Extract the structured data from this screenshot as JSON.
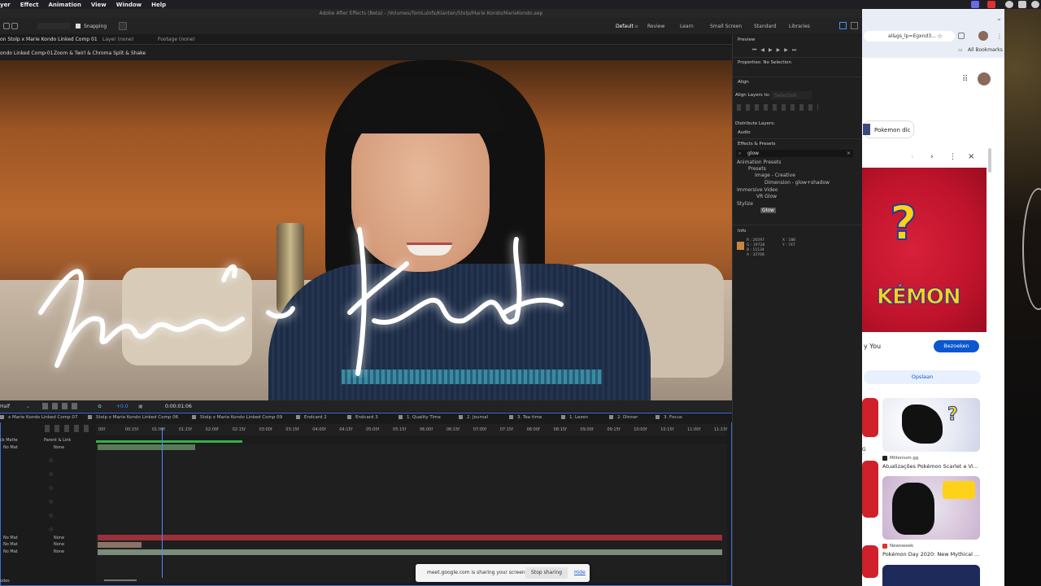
{
  "menubar": {
    "items": [
      "yer",
      "Effect",
      "Animation",
      "View",
      "Window",
      "Help"
    ]
  },
  "app": {
    "title": "Adobe After Effects (Beta) - /Volumes/TomLulofs/Klanten/Stolp/Marie Kondo/MarieKondo.aep",
    "toolbar": {
      "snapping": "Snapping"
    },
    "workspaces": [
      "Default",
      "Review",
      "Learn",
      "Small Screen",
      "Standard",
      "Libraries"
    ]
  },
  "viewer": {
    "tabs": [
      "on Stolp x Marie Kondo Linked Comp 01",
      "Layer (none)",
      "Footage (none)"
    ],
    "crumbs": [
      "ondo Linked Comp 01",
      "Zoom & Twirl & Chroma Split & Shake"
    ],
    "resolution": "Half",
    "timecode": "0:00:01:06",
    "exposure": "+0.0"
  },
  "panels": {
    "preview": "Preview",
    "properties": "Properties: No Selection",
    "align": "Align",
    "align_layers_to": "Align Layers to:",
    "align_target": "Selection",
    "distribute": "Distribute Layers:",
    "audio": "Audio",
    "effects": "Effects & Presets",
    "search_value": "glow",
    "tree": [
      "Animation Presets",
      "Presets",
      "Image - Creative",
      "Dimension - glow+shadow",
      "Immersive Video",
      "VR Glow",
      "Stylize",
      "Glow"
    ],
    "info": "Info",
    "info_values": [
      "R : 26597",
      "G : 19728",
      "B : 11134",
      "A : 32768"
    ],
    "info_xy": [
      "X : 188",
      "Y : 747"
    ]
  },
  "timeline": {
    "tabs": [
      "x Marie Kondo Linked Comp 07",
      "Stolp x Marie Kondo Linked Comp 06",
      "Stolp x Marie Kondo Linked Comp 09",
      "Endcard 2",
      "Endcard 3",
      "1. Quality Time",
      "2. Journal",
      "3. Tea time",
      "1. Lezen",
      "2. Dinner",
      "3. Focus"
    ],
    "ticks": [
      "00f",
      "00:15f",
      "01:00f",
      "01:15f",
      "02:00f",
      "02:15f",
      "03:00f",
      "03:15f",
      "04:00f",
      "04:15f",
      "05:00f",
      "05:15f",
      "06:00f",
      "06:15f",
      "07:00f",
      "07:15f",
      "08:00f",
      "08:15f",
      "09:00f",
      "09:15f",
      "10:00f",
      "10:15f",
      "11:00f",
      "11:15f"
    ],
    "col_parent": "Parent & Link",
    "col_matte": "ck Matte",
    "none": "None",
    "nomat": "No Mat",
    "toggles": "odes"
  },
  "share": {
    "text": "meet.google.com is sharing your screen.",
    "stop": "Stop sharing",
    "hide": "Hide"
  },
  "browser": {
    "url": "al&gs_lp=Egxnd3...",
    "bookmarks": "All Bookmarks",
    "chip": "Pokemon dlc",
    "card_word": "KÉMON",
    "for_you": "y You",
    "visit": "Bezoeken",
    "save": "Opslaan",
    "results": [
      {
        "source": "Millenium.gg",
        "caption": "Atualizações Pokémon Scarlet e Vi..."
      },
      {
        "source": "Newsweek",
        "caption": "Pokémon Day 2020: New Mythical ..."
      }
    ],
    "colors": {
      "accent": "#0b57d0",
      "card_red": "#c0142c",
      "pokemon_yellow": "#ffd21a"
    }
  }
}
